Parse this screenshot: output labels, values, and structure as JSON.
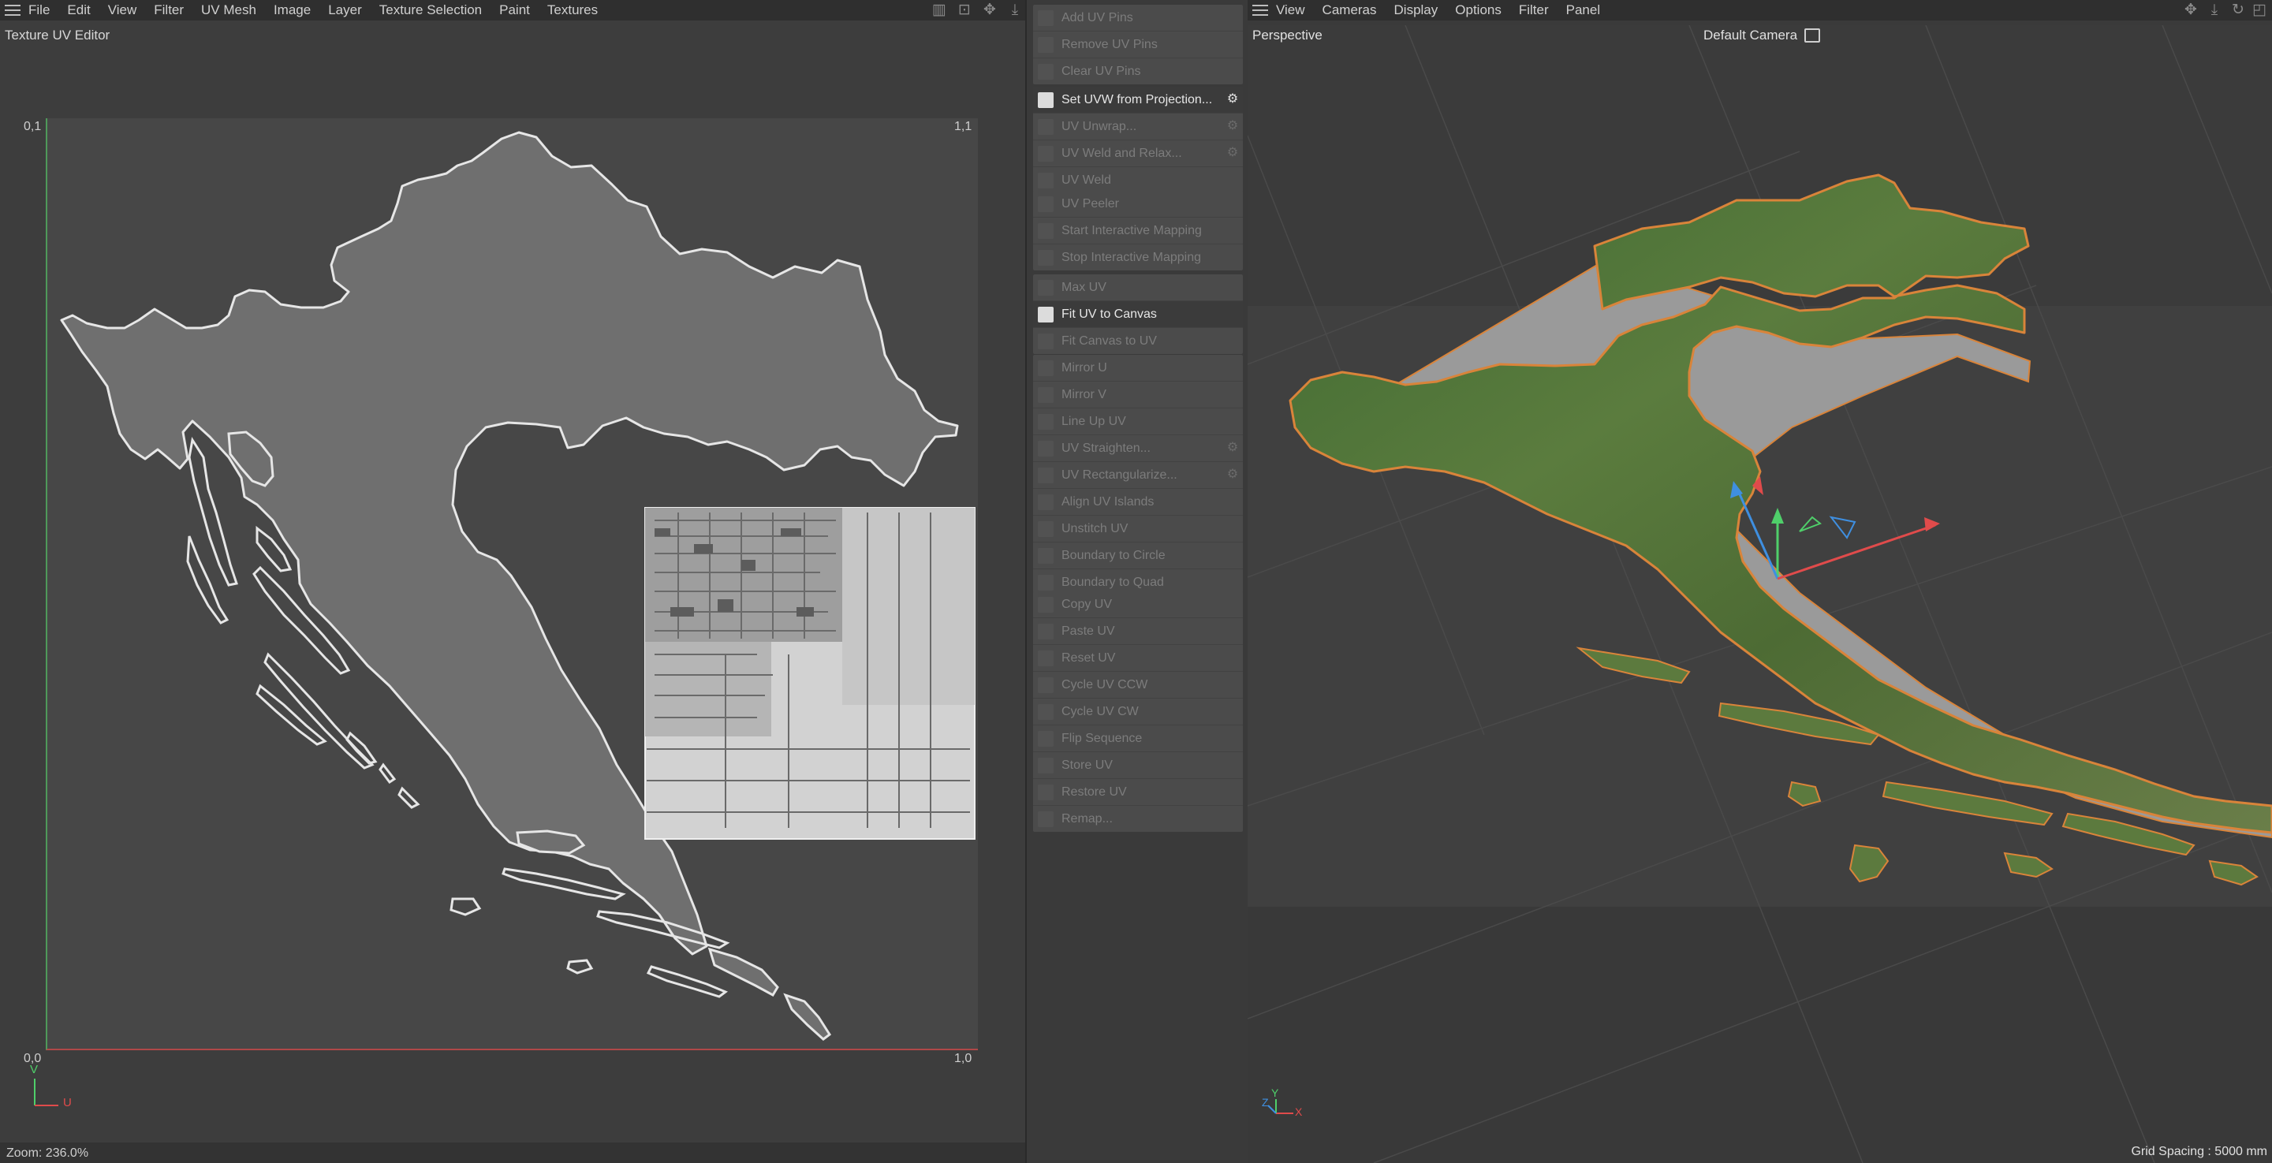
{
  "uv_editor": {
    "menu": [
      "File",
      "Edit",
      "View",
      "Filter",
      "UV Mesh",
      "Image",
      "Layer",
      "Texture Selection",
      "Paint",
      "Textures"
    ],
    "title": "Texture UV Editor",
    "corners": {
      "top_left": "0,1",
      "top_right": "1,1",
      "bottom_left": "0,0",
      "bottom_right": "1,0"
    },
    "axis_v": "V",
    "axis_u": "U",
    "zoom": "Zoom: 236.0%",
    "toolbar_icons": [
      "histogram-icon",
      "lock-icon",
      "move-icon",
      "download-icon"
    ]
  },
  "commands": {
    "groups": [
      [
        {
          "label": "Add UV Pins",
          "enabled": false,
          "gear": false
        },
        {
          "label": "Remove UV Pins",
          "enabled": false,
          "gear": false
        },
        {
          "label": "Clear UV Pins",
          "enabled": false,
          "gear": false
        }
      ],
      [
        {
          "label": "Set UVW from Projection...",
          "enabled": true,
          "gear": true
        },
        {
          "label": "UV Unwrap...",
          "enabled": false,
          "gear": true
        },
        {
          "label": "UV Weld and Relax...",
          "enabled": false,
          "gear": true
        },
        {
          "label": "UV Weld",
          "enabled": false,
          "gear": false
        }
      ],
      [
        {
          "label": "UV Peeler",
          "enabled": false,
          "gear": false
        },
        {
          "label": "Start Interactive Mapping",
          "enabled": false,
          "gear": false
        },
        {
          "label": "Stop Interactive Mapping",
          "enabled": false,
          "gear": false
        }
      ],
      [
        {
          "label": "Max UV",
          "enabled": false,
          "gear": false
        },
        {
          "label": "Fit UV to Canvas",
          "enabled": true,
          "gear": false
        },
        {
          "label": "Fit Canvas to UV",
          "enabled": false,
          "gear": false
        }
      ],
      [
        {
          "label": "Mirror U",
          "enabled": false,
          "gear": false
        },
        {
          "label": "Mirror V",
          "enabled": false,
          "gear": false
        },
        {
          "label": "Line Up UV",
          "enabled": false,
          "gear": false
        },
        {
          "label": "UV Straighten...",
          "enabled": false,
          "gear": true
        },
        {
          "label": "UV Rectangularize...",
          "enabled": false,
          "gear": true
        },
        {
          "label": "Align UV Islands",
          "enabled": false,
          "gear": false
        },
        {
          "label": "Unstitch UV",
          "enabled": false,
          "gear": false
        },
        {
          "label": "Boundary to Circle",
          "enabled": false,
          "gear": false
        },
        {
          "label": "Boundary to Quad",
          "enabled": false,
          "gear": false
        }
      ],
      [
        {
          "label": "Copy UV",
          "enabled": false,
          "gear": false
        },
        {
          "label": "Paste UV",
          "enabled": false,
          "gear": false
        },
        {
          "label": "Reset UV",
          "enabled": false,
          "gear": false
        },
        {
          "label": "Cycle UV CCW",
          "enabled": false,
          "gear": false
        },
        {
          "label": "Cycle UV CW",
          "enabled": false,
          "gear": false
        },
        {
          "label": "Flip Sequence",
          "enabled": false,
          "gear": false
        },
        {
          "label": "Store UV",
          "enabled": false,
          "gear": false
        },
        {
          "label": "Restore UV",
          "enabled": false,
          "gear": false
        },
        {
          "label": "Remap...",
          "enabled": false,
          "gear": false
        }
      ]
    ]
  },
  "viewport": {
    "menu": [
      "View",
      "Cameras",
      "Display",
      "Options",
      "Filter",
      "Panel"
    ],
    "view_name": "Perspective",
    "camera": "Default Camera",
    "grid_spacing": "Grid Spacing : 5000 mm",
    "mini_axes": {
      "x": "X",
      "y": "Y",
      "z": "Z"
    },
    "toolbar_icons": [
      "move-icon",
      "download-icon",
      "rotate-icon",
      "maximize-icon"
    ]
  },
  "colors": {
    "axis_x": "#e04b4b",
    "axis_y": "#4fcf6a",
    "axis_z": "#3f8fe0",
    "selection_outline": "#d9843a"
  }
}
